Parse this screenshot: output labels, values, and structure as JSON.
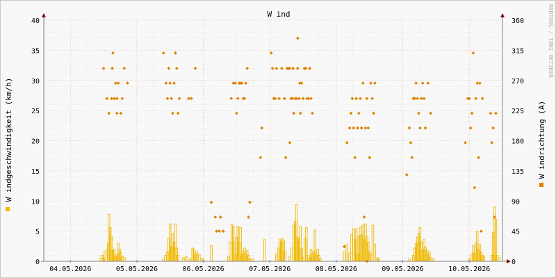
{
  "chart_data": {
    "type": "bar+scatter",
    "title": "W ind",
    "watermark": "RRDTOOL / TOBI OETIKER",
    "ylabel_left": "W indgeschwindigkeit (km/h)",
    "ylabel_right": "W indrichtung (A)",
    "y_left_ticks": [
      "0",
      "5",
      "10",
      "15",
      "20",
      "25",
      "30",
      "35",
      "40"
    ],
    "y_right_ticks": [
      "0",
      "45",
      "90",
      "135",
      "180",
      "225",
      "270",
      "315",
      "360"
    ],
    "ylim_left": [
      0,
      40
    ],
    "ylim_right": [
      0,
      360
    ],
    "x_range_days": [
      3.6,
      10.5
    ],
    "x_tick_labels": [
      "04.05.2026",
      "05.05.2026",
      "06.05.2026",
      "07.05.2026",
      "08.05.2026",
      "09.05.2026",
      "10.05.2026"
    ],
    "x_tick_days": [
      4,
      5,
      6,
      7,
      8,
      9,
      10
    ],
    "colors": {
      "speed": "#f0b800",
      "direction": "#e08000",
      "grid": "#e8a0a0",
      "axis": "#808080",
      "arrow": "#800000"
    },
    "series": [
      {
        "name": "Windgeschwindigkeit",
        "kind": "bars",
        "points": [
          [
            4.45,
            0.5
          ],
          [
            4.48,
            1.0
          ],
          [
            4.5,
            0.6
          ],
          [
            4.52,
            1.6
          ],
          [
            4.55,
            2.0
          ],
          [
            4.57,
            3.0
          ],
          [
            4.58,
            7.8
          ],
          [
            4.6,
            5.6
          ],
          [
            4.62,
            4.2
          ],
          [
            4.64,
            1.8
          ],
          [
            4.66,
            2.0
          ],
          [
            4.68,
            0.8
          ],
          [
            4.7,
            1.2
          ],
          [
            4.72,
            3.0
          ],
          [
            4.74,
            2.0
          ],
          [
            4.76,
            1.4
          ],
          [
            4.78,
            0.8
          ],
          [
            4.82,
            0.6
          ],
          [
            5.4,
            0.4
          ],
          [
            5.43,
            1.0
          ],
          [
            5.46,
            1.6
          ],
          [
            5.48,
            3.8
          ],
          [
            5.5,
            6.2
          ],
          [
            5.52,
            2.4
          ],
          [
            5.54,
            4.6
          ],
          [
            5.56,
            3.2
          ],
          [
            5.58,
            6.2
          ],
          [
            5.6,
            2.2
          ],
          [
            5.62,
            1.0
          ],
          [
            5.7,
            0.6
          ],
          [
            5.74,
            0.8
          ],
          [
            5.8,
            0.4
          ],
          [
            5.84,
            2.2
          ],
          [
            5.86,
            2.0
          ],
          [
            5.88,
            1.2
          ],
          [
            5.9,
            1.6
          ],
          [
            5.94,
            1.2
          ],
          [
            5.97,
            0.4
          ],
          [
            6.0,
            0.4
          ],
          [
            6.12,
            2.6
          ],
          [
            6.38,
            0.8
          ],
          [
            6.4,
            3.2
          ],
          [
            6.43,
            6.2
          ],
          [
            6.45,
            5.8
          ],
          [
            6.47,
            3.2
          ],
          [
            6.49,
            1.2
          ],
          [
            6.5,
            4.0
          ],
          [
            6.52,
            5.8
          ],
          [
            6.54,
            3.2
          ],
          [
            6.56,
            5.6
          ],
          [
            6.58,
            1.2
          ],
          [
            6.6,
            1.6
          ],
          [
            6.62,
            2.2
          ],
          [
            6.64,
            1.2
          ],
          [
            6.66,
            1.8
          ],
          [
            6.68,
            1.0
          ],
          [
            6.7,
            0.4
          ],
          [
            6.74,
            0.4
          ],
          [
            6.92,
            3.6
          ],
          [
            7.1,
            1.2
          ],
          [
            7.13,
            2.2
          ],
          [
            7.15,
            3.6
          ],
          [
            7.17,
            3.2
          ],
          [
            7.19,
            3.8
          ],
          [
            7.21,
            3.4
          ],
          [
            7.23,
            1.6
          ],
          [
            7.3,
            0.8
          ],
          [
            7.33,
            2.2
          ],
          [
            7.36,
            6.0
          ],
          [
            7.38,
            6.6
          ],
          [
            7.4,
            9.4
          ],
          [
            7.42,
            4.0
          ],
          [
            7.44,
            3.6
          ],
          [
            7.46,
            5.8
          ],
          [
            7.48,
            2.2
          ],
          [
            7.5,
            0.6
          ],
          [
            7.53,
            3.8
          ],
          [
            7.55,
            5.6
          ],
          [
            7.58,
            1.0
          ],
          [
            7.6,
            0.6
          ],
          [
            7.62,
            2.0
          ],
          [
            7.64,
            1.2
          ],
          [
            7.66,
            1.6
          ],
          [
            7.68,
            5.2
          ],
          [
            7.7,
            1.2
          ],
          [
            7.72,
            2.0
          ],
          [
            7.74,
            1.0
          ],
          [
            7.76,
            0.4
          ],
          [
            8.12,
            1.6
          ],
          [
            8.16,
            2.8
          ],
          [
            8.2,
            1.4
          ],
          [
            8.23,
            4.4
          ],
          [
            8.26,
            5.4
          ],
          [
            8.28,
            3.6
          ],
          [
            8.3,
            5.4
          ],
          [
            8.32,
            1.2
          ],
          [
            8.34,
            4.2
          ],
          [
            8.36,
            5.6
          ],
          [
            8.38,
            4.4
          ],
          [
            8.4,
            6.0
          ],
          [
            8.42,
            3.6
          ],
          [
            8.44,
            6.2
          ],
          [
            8.46,
            4.2
          ],
          [
            8.48,
            3.2
          ],
          [
            8.5,
            1.6
          ],
          [
            8.52,
            1.2
          ],
          [
            8.55,
            6.0
          ],
          [
            8.58,
            2.8
          ],
          [
            8.62,
            0.6
          ],
          [
            8.64,
            0.4
          ],
          [
            9.1,
            0.4
          ],
          [
            9.16,
            1.0
          ],
          [
            9.18,
            2.2
          ],
          [
            9.2,
            3.0
          ],
          [
            9.22,
            4.0
          ],
          [
            9.24,
            4.6
          ],
          [
            9.26,
            5.6
          ],
          [
            9.28,
            3.2
          ],
          [
            9.3,
            2.0
          ],
          [
            9.32,
            3.6
          ],
          [
            9.34,
            2.4
          ],
          [
            9.36,
            1.8
          ],
          [
            9.38,
            1.2
          ],
          [
            9.4,
            1.6
          ],
          [
            9.42,
            0.6
          ],
          [
            9.46,
            0.4
          ],
          [
            10.0,
            0.4
          ],
          [
            10.04,
            1.2
          ],
          [
            10.06,
            2.6
          ],
          [
            10.08,
            1.4
          ],
          [
            10.1,
            3.0
          ],
          [
            10.12,
            5.0
          ],
          [
            10.14,
            2.0
          ],
          [
            10.16,
            2.8
          ],
          [
            10.18,
            1.6
          ],
          [
            10.2,
            1.0
          ],
          [
            10.22,
            0.8
          ],
          [
            10.34,
            1.0
          ],
          [
            10.36,
            4.8
          ],
          [
            10.38,
            9.0
          ],
          [
            10.4,
            7.0
          ],
          [
            10.42,
            1.0
          ],
          [
            10.45,
            0.6
          ]
        ]
      },
      {
        "name": "Windrichtung",
        "kind": "points",
        "axis": "right",
        "points": [
          [
            4.5,
            288
          ],
          [
            4.55,
            243
          ],
          [
            4.58,
            221
          ],
          [
            4.62,
            243
          ],
          [
            4.66,
            243
          ],
          [
            4.63,
            288
          ],
          [
            4.7,
            221
          ],
          [
            4.76,
            221
          ],
          [
            4.78,
            243
          ],
          [
            4.81,
            288
          ],
          [
            4.68,
            266
          ],
          [
            4.72,
            266
          ],
          [
            4.64,
            311
          ],
          [
            4.7,
            243
          ],
          [
            4.86,
            266
          ],
          [
            5.4,
            311
          ],
          [
            5.44,
            266
          ],
          [
            5.46,
            243
          ],
          [
            5.48,
            288
          ],
          [
            5.5,
            266
          ],
          [
            5.52,
            243
          ],
          [
            5.54,
            221
          ],
          [
            5.56,
            266
          ],
          [
            5.58,
            311
          ],
          [
            5.6,
            288
          ],
          [
            5.62,
            221
          ],
          [
            5.64,
            243
          ],
          [
            5.78,
            243
          ],
          [
            5.82,
            243
          ],
          [
            5.88,
            288
          ],
          [
            6.12,
            88
          ],
          [
            6.18,
            66
          ],
          [
            6.2,
            45
          ],
          [
            6.24,
            45
          ],
          [
            6.26,
            66
          ],
          [
            6.3,
            45
          ],
          [
            6.42,
            243
          ],
          [
            6.45,
            266
          ],
          [
            6.48,
            266
          ],
          [
            6.5,
            221
          ],
          [
            6.52,
            243
          ],
          [
            6.54,
            266
          ],
          [
            6.56,
            266
          ],
          [
            6.58,
            266
          ],
          [
            6.6,
            243
          ],
          [
            6.62,
            243
          ],
          [
            6.64,
            266
          ],
          [
            6.66,
            288
          ],
          [
            6.68,
            66
          ],
          [
            6.7,
            88
          ],
          [
            6.86,
            155
          ],
          [
            6.88,
            199
          ],
          [
            7.02,
            311
          ],
          [
            7.04,
            288
          ],
          [
            7.06,
            243
          ],
          [
            7.08,
            243
          ],
          [
            7.1,
            288
          ],
          [
            7.14,
            243
          ],
          [
            7.18,
            288
          ],
          [
            7.22,
            243
          ],
          [
            7.24,
            155
          ],
          [
            7.26,
            288
          ],
          [
            7.28,
            288
          ],
          [
            7.3,
            288
          ],
          [
            7.32,
            243
          ],
          [
            7.34,
            243
          ],
          [
            7.36,
            221
          ],
          [
            7.38,
            243
          ],
          [
            7.4,
            243
          ],
          [
            7.42,
            288
          ],
          [
            7.44,
            243
          ],
          [
            7.46,
            221
          ],
          [
            7.48,
            266
          ],
          [
            7.5,
            243
          ],
          [
            7.52,
            288
          ],
          [
            7.54,
            288
          ],
          [
            7.56,
            243
          ],
          [
            7.58,
            243
          ],
          [
            7.6,
            288
          ],
          [
            7.62,
            243
          ],
          [
            7.64,
            221
          ],
          [
            7.3,
            177
          ],
          [
            7.42,
            333
          ],
          [
            7.45,
            266
          ],
          [
            7.35,
            288
          ],
          [
            8.12,
            22
          ],
          [
            8.16,
            177
          ],
          [
            8.2,
            199
          ],
          [
            8.22,
            221
          ],
          [
            8.24,
            243
          ],
          [
            8.26,
            199
          ],
          [
            8.28,
            155
          ],
          [
            8.3,
            243
          ],
          [
            8.32,
            199
          ],
          [
            8.34,
            221
          ],
          [
            8.36,
            243
          ],
          [
            8.38,
            199
          ],
          [
            8.4,
            266
          ],
          [
            8.42,
            66
          ],
          [
            8.44,
            199
          ],
          [
            8.46,
            243
          ],
          [
            8.48,
            199
          ],
          [
            8.5,
            155
          ],
          [
            8.52,
            266
          ],
          [
            8.54,
            243
          ],
          [
            8.56,
            221
          ],
          [
            8.58,
            266
          ],
          [
            8.46,
            0
          ],
          [
            9.06,
            129
          ],
          [
            9.1,
            199
          ],
          [
            9.12,
            177
          ],
          [
            9.14,
            155
          ],
          [
            9.16,
            243
          ],
          [
            9.18,
            243
          ],
          [
            9.2,
            266
          ],
          [
            9.22,
            243
          ],
          [
            9.24,
            221
          ],
          [
            9.26,
            199
          ],
          [
            9.28,
            243
          ],
          [
            9.3,
            266
          ],
          [
            9.32,
            243
          ],
          [
            9.34,
            199
          ],
          [
            9.38,
            266
          ],
          [
            9.42,
            221
          ],
          [
            9.94,
            177
          ],
          [
            9.98,
            243
          ],
          [
            10.0,
            243
          ],
          [
            10.02,
            199
          ],
          [
            10.04,
            221
          ],
          [
            10.06,
            311
          ],
          [
            10.08,
            110
          ],
          [
            10.1,
            243
          ],
          [
            10.12,
            266
          ],
          [
            10.14,
            155
          ],
          [
            10.16,
            266
          ],
          [
            10.18,
            45
          ],
          [
            10.2,
            243
          ],
          [
            10.32,
            221
          ],
          [
            10.34,
            177
          ],
          [
            10.36,
            199
          ],
          [
            10.38,
            66
          ],
          [
            10.4,
            221
          ]
        ]
      }
    ]
  }
}
